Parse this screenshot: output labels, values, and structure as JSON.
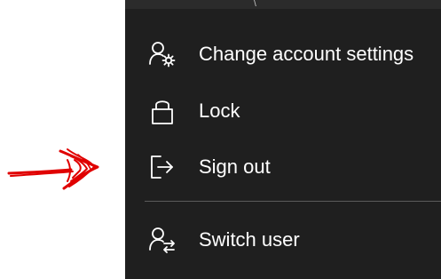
{
  "menu": {
    "items": [
      {
        "label": "Change account settings",
        "icon": "account-settings-icon"
      },
      {
        "label": "Lock",
        "icon": "lock-icon"
      },
      {
        "label": "Sign out",
        "icon": "sign-out-icon"
      }
    ],
    "secondary_items": [
      {
        "label": "Switch user",
        "icon": "switch-user-icon"
      }
    ]
  },
  "colors": {
    "menu_background": "#1f1f1f",
    "text": "#ffffff",
    "divider": "#5a5a5a",
    "annotation_arrow": "#e00000"
  }
}
